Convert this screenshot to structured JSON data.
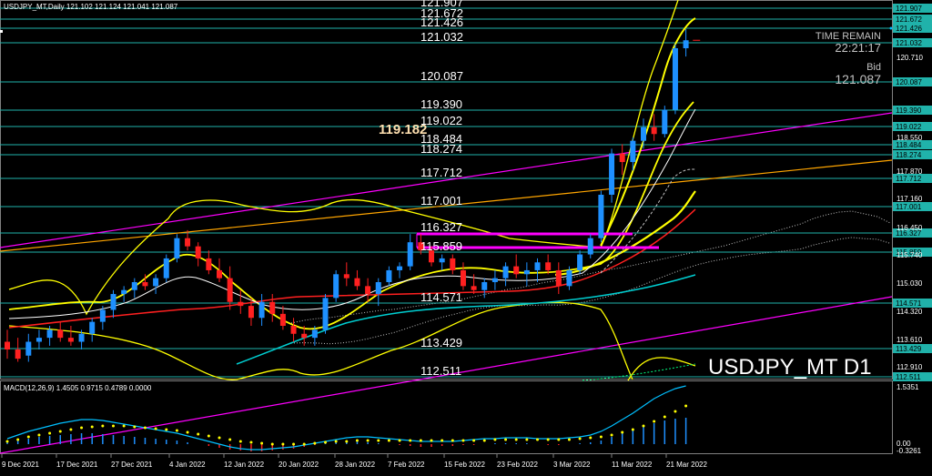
{
  "header": {
    "info": "USDJPY_MT,Daily  121.102 121.124 121.041 121.087"
  },
  "overlay": {
    "time_remain_label": "TIME REMAIN",
    "time_remain_value": "22:21:17",
    "bid_label": "Bid",
    "bid_value": "121.087",
    "cursor_price": "119.182",
    "watermark": "USDJPY_MT D1"
  },
  "colors": {
    "background": "#000000",
    "bull_candle": "#1e90ff",
    "bear_candle": "#ff2020",
    "level_line": "#20b2aa",
    "bollinger": "#ffff00",
    "trendline_magenta": "#ff00ff",
    "trendline_orange": "#ffa500",
    "signal_dots": "#ffff00",
    "macd_line": "#00bfff"
  },
  "levels": [
    {
      "label": "121.907",
      "value": 121.907,
      "axis": "121.907"
    },
    {
      "label": "121.672",
      "value": 121.672,
      "axis": "121.672"
    },
    {
      "label": "121.426",
      "value": 121.426,
      "axis": "121.426"
    },
    {
      "label": "121.032",
      "value": 121.032,
      "axis": "121.032"
    },
    {
      "label": "120.087",
      "value": 120.087,
      "axis": "120.087"
    },
    {
      "label": "119.390",
      "value": 119.39,
      "axis": "119.390"
    },
    {
      "label": "119.022",
      "value": 119.022,
      "axis": "119.022"
    },
    {
      "label": "118.484",
      "value": 118.484,
      "axis": "118.484"
    },
    {
      "label": "118.274",
      "value": 118.274,
      "axis": "118.274"
    },
    {
      "label": "117.712",
      "value": 117.712,
      "axis": "117.712"
    },
    {
      "label": "117.001",
      "value": 117.001,
      "axis": "117.001"
    },
    {
      "label": "116.327",
      "value": 116.327,
      "axis": "116.327"
    },
    {
      "label": "115.859",
      "value": 115.859,
      "axis": "115.859"
    },
    {
      "label": "114.571",
      "value": 114.571,
      "axis": "114.571"
    },
    {
      "label": "113.429",
      "value": 113.429,
      "axis": "113.429"
    },
    {
      "label": "112.511",
      "value": 112.511,
      "axis": "112.511"
    }
  ],
  "axis_plain_ticks": [
    "120.710",
    "118.550",
    "117.870",
    "117.160",
    "116.450",
    "115.740",
    "115.030",
    "114.320",
    "113.610",
    "112.910"
  ],
  "macd": {
    "label": "MACD(12,26,9) 1.4505 0.9715 0.4789 0.0000",
    "axis_top": "1.5351",
    "axis_zero": "0.00",
    "axis_bottom": "-0.3261"
  },
  "date_labels": [
    "9 Dec 2021",
    "17 Dec 2021",
    "27 Dec 2021",
    "4 Jan 2022",
    "12 Jan 2022",
    "20 Jan 2022",
    "28 Jan 2022",
    "7 Feb 2022",
    "15 Feb 2022",
    "23 Feb 2022",
    "3 Mar 2022",
    "11 Mar 2022",
    "21 Mar 2022"
  ],
  "chart_data": {
    "type": "candlestick",
    "symbol": "USDJPY_MT",
    "timeframe": "Daily",
    "ylim": [
      112.6,
      122.1
    ],
    "candles": [
      {
        "o": 113.6,
        "h": 113.9,
        "l": 113.1,
        "c": 113.4
      },
      {
        "o": 113.4,
        "h": 113.7,
        "l": 113.0,
        "c": 113.1
      },
      {
        "o": 113.2,
        "h": 113.8,
        "l": 113.0,
        "c": 113.6
      },
      {
        "o": 113.6,
        "h": 113.9,
        "l": 113.4,
        "c": 113.7
      },
      {
        "o": 113.7,
        "h": 114.0,
        "l": 113.5,
        "c": 113.9
      },
      {
        "o": 113.9,
        "h": 114.1,
        "l": 113.6,
        "c": 113.7
      },
      {
        "o": 113.7,
        "h": 114.0,
        "l": 113.5,
        "c": 113.6
      },
      {
        "o": 113.6,
        "h": 113.9,
        "l": 113.4,
        "c": 113.8
      },
      {
        "o": 113.8,
        "h": 114.2,
        "l": 113.6,
        "c": 114.1
      },
      {
        "o": 114.1,
        "h": 114.5,
        "l": 113.9,
        "c": 114.4
      },
      {
        "o": 114.4,
        "h": 114.9,
        "l": 114.2,
        "c": 114.8
      },
      {
        "o": 114.8,
        "h": 115.0,
        "l": 114.6,
        "c": 114.9
      },
      {
        "o": 114.9,
        "h": 115.2,
        "l": 114.7,
        "c": 115.1
      },
      {
        "o": 115.1,
        "h": 115.3,
        "l": 114.9,
        "c": 115.0
      },
      {
        "o": 115.0,
        "h": 115.3,
        "l": 114.8,
        "c": 115.2
      },
      {
        "o": 115.2,
        "h": 115.8,
        "l": 115.1,
        "c": 115.7
      },
      {
        "o": 115.7,
        "h": 116.3,
        "l": 115.6,
        "c": 116.2
      },
      {
        "o": 116.2,
        "h": 116.4,
        "l": 115.9,
        "c": 116.0
      },
      {
        "o": 116.0,
        "h": 116.1,
        "l": 115.5,
        "c": 115.7
      },
      {
        "o": 115.7,
        "h": 115.9,
        "l": 115.3,
        "c": 115.4
      },
      {
        "o": 115.4,
        "h": 115.7,
        "l": 115.1,
        "c": 115.2
      },
      {
        "o": 115.2,
        "h": 115.5,
        "l": 114.4,
        "c": 114.6
      },
      {
        "o": 114.6,
        "h": 114.9,
        "l": 114.3,
        "c": 114.5
      },
      {
        "o": 114.5,
        "h": 114.7,
        "l": 114.0,
        "c": 114.2
      },
      {
        "o": 114.2,
        "h": 114.8,
        "l": 114.0,
        "c": 114.6
      },
      {
        "o": 114.6,
        "h": 114.8,
        "l": 114.1,
        "c": 114.3
      },
      {
        "o": 114.3,
        "h": 114.5,
        "l": 113.9,
        "c": 114.0
      },
      {
        "o": 114.0,
        "h": 114.2,
        "l": 113.6,
        "c": 113.8
      },
      {
        "o": 113.8,
        "h": 114.0,
        "l": 113.5,
        "c": 113.7
      },
      {
        "o": 113.7,
        "h": 114.0,
        "l": 113.5,
        "c": 113.9
      },
      {
        "o": 113.9,
        "h": 114.8,
        "l": 113.8,
        "c": 114.7
      },
      {
        "o": 114.7,
        "h": 115.4,
        "l": 114.6,
        "c": 115.3
      },
      {
        "o": 115.3,
        "h": 115.6,
        "l": 115.0,
        "c": 115.2
      },
      {
        "o": 115.2,
        "h": 115.4,
        "l": 114.9,
        "c": 115.0
      },
      {
        "o": 115.0,
        "h": 115.2,
        "l": 114.6,
        "c": 114.8
      },
      {
        "o": 114.8,
        "h": 115.2,
        "l": 114.5,
        "c": 115.1
      },
      {
        "o": 115.1,
        "h": 115.5,
        "l": 115.0,
        "c": 115.4
      },
      {
        "o": 115.4,
        "h": 115.6,
        "l": 115.2,
        "c": 115.5
      },
      {
        "o": 115.5,
        "h": 116.3,
        "l": 115.4,
        "c": 116.1
      },
      {
        "o": 116.1,
        "h": 116.3,
        "l": 115.8,
        "c": 115.9
      },
      {
        "o": 115.9,
        "h": 116.0,
        "l": 115.5,
        "c": 115.6
      },
      {
        "o": 115.6,
        "h": 115.8,
        "l": 115.4,
        "c": 115.7
      },
      {
        "o": 115.7,
        "h": 115.8,
        "l": 115.3,
        "c": 115.4
      },
      {
        "o": 115.4,
        "h": 115.6,
        "l": 114.9,
        "c": 115.0
      },
      {
        "o": 115.0,
        "h": 115.3,
        "l": 114.8,
        "c": 114.9
      },
      {
        "o": 114.9,
        "h": 115.2,
        "l": 114.7,
        "c": 115.1
      },
      {
        "o": 115.1,
        "h": 115.4,
        "l": 114.9,
        "c": 115.2
      },
      {
        "o": 115.2,
        "h": 115.6,
        "l": 115.0,
        "c": 115.5
      },
      {
        "o": 115.5,
        "h": 115.8,
        "l": 115.2,
        "c": 115.3
      },
      {
        "o": 115.3,
        "h": 115.6,
        "l": 115.0,
        "c": 115.4
      },
      {
        "o": 115.4,
        "h": 115.7,
        "l": 115.1,
        "c": 115.6
      },
      {
        "o": 115.6,
        "h": 115.8,
        "l": 115.3,
        "c": 115.4
      },
      {
        "o": 115.4,
        "h": 115.6,
        "l": 114.8,
        "c": 115.0
      },
      {
        "o": 115.0,
        "h": 115.5,
        "l": 114.9,
        "c": 115.4
      },
      {
        "o": 115.4,
        "h": 115.9,
        "l": 115.3,
        "c": 115.8
      },
      {
        "o": 115.8,
        "h": 116.3,
        "l": 115.7,
        "c": 116.2
      },
      {
        "o": 116.2,
        "h": 117.4,
        "l": 116.1,
        "c": 117.3
      },
      {
        "o": 117.3,
        "h": 118.4,
        "l": 117.1,
        "c": 118.3
      },
      {
        "o": 118.3,
        "h": 118.5,
        "l": 117.8,
        "c": 118.1
      },
      {
        "o": 118.1,
        "h": 118.7,
        "l": 117.9,
        "c": 118.6
      },
      {
        "o": 118.6,
        "h": 119.2,
        "l": 118.4,
        "c": 119.0
      },
      {
        "o": 119.0,
        "h": 119.3,
        "l": 118.6,
        "c": 118.8
      },
      {
        "o": 118.8,
        "h": 119.5,
        "l": 118.7,
        "c": 119.4
      },
      {
        "o": 119.4,
        "h": 121.0,
        "l": 119.3,
        "c": 120.9
      },
      {
        "o": 120.9,
        "h": 121.4,
        "l": 120.7,
        "c": 121.1
      }
    ]
  }
}
